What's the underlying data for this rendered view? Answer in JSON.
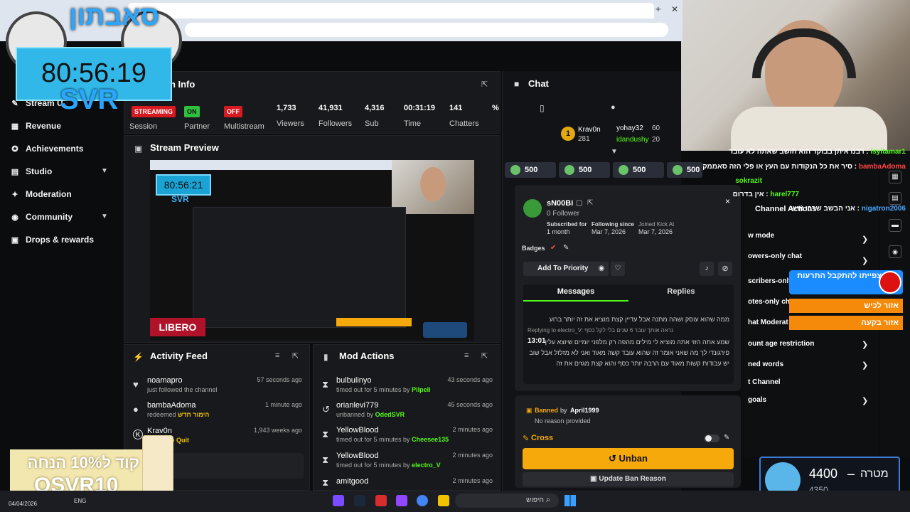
{
  "overlay": {
    "timer": "80:56:19",
    "timer_sub": "SVR",
    "logo_text": "סאבתון",
    "promo_code": "קוד ל10% הנחה",
    "promo_code2": "OSVR10",
    "libero": "LIBERO",
    "goal_label": "מטרה",
    "goal_value": "4400",
    "goal_sep": "–",
    "goal_sub": "4350",
    "alert_title": "צפייתו להתקבל התרעות",
    "alert_bar1": "אזור לכיש",
    "alert_bar2": "אזור בקעה",
    "chat_close": "×"
  },
  "overlay_chat": [
    {
      "user": "isyitamar1",
      "text": "רבנו איתן בבוקר הוא חושב שאתה לא עובר",
      "color": "#53fc18"
    },
    {
      "user": "bambaAdoma",
      "text": "סיר את כל הנקודות עם העץ או פלי הזה סאממק",
      "color": "#ff4444"
    },
    {
      "user": "sokrazit",
      "text": "",
      "color": "#53fc18"
    },
    {
      "user": "harel777",
      "text": "אין בדרום",
      "color": "#53fc18"
    },
    {
      "user": "nigatron2006",
      "text": "אני הבשב שרבו איש",
      "color": "#4aa8ff"
    }
  ],
  "browser": {
    "close": "✕",
    "new_tab": "+"
  },
  "sidebar": {
    "items": [
      {
        "label": "Stream U",
        "icon": "✎"
      },
      {
        "label": "Revenue",
        "icon": "▦"
      },
      {
        "label": "Achievements",
        "icon": "✪"
      },
      {
        "label": "Studio",
        "icon": "▤"
      },
      {
        "label": "Moderation",
        "icon": "✦"
      },
      {
        "label": "Community",
        "icon": "◉"
      },
      {
        "label": "Drops & rewards",
        "icon": "▣"
      }
    ]
  },
  "session": {
    "title": "on Info",
    "badges": {
      "streaming": "STREAMING",
      "on": "ON",
      "off": "OFF"
    },
    "labels": {
      "session": "Session",
      "partner": "Partner",
      "multistream": "Multistream"
    },
    "stats": [
      {
        "value": "1,733",
        "label": "Viewers"
      },
      {
        "value": "41,931",
        "label": "Followers"
      },
      {
        "value": "4,316",
        "label": "Sub Count"
      },
      {
        "value": "00:31:19",
        "label": "Time Live"
      },
      {
        "value": "141",
        "label": "Chatters in t..."
      },
      {
        "value": "%",
        "label": ""
      }
    ]
  },
  "preview": {
    "title": "Stream Preview",
    "timer": "80:56:21",
    "sub": "SVR"
  },
  "activity": {
    "title": "Activity Feed",
    "items": [
      {
        "name": "noamapro",
        "sub": "just followed the channel",
        "time": "57 seconds ago",
        "icon": "♥"
      },
      {
        "name": "bambaAdoma",
        "sub": "redeemed",
        "highlight": "הימור חדש",
        "time": "1 minute ago",
        "icon": "●"
      },
      {
        "name": "Krav0n",
        "sub": "just",
        "highlight": "Rage Quit",
        "time": "1,943 weeks ago",
        "icon": "K"
      },
      {
        "name": "",
        "sub": "",
        "time": "",
        "icon": ""
      }
    ]
  },
  "mod": {
    "title": "Mod Actions",
    "items": [
      {
        "name": "bulbulinyo",
        "sub": "timed out for 5 minutes by",
        "by": "Pilpeli",
        "time": "43 seconds ago",
        "icon": "⧗"
      },
      {
        "name": "orianlevi779",
        "sub": "unbanned by",
        "by": "OdedSVR",
        "time": "45 seconds ago",
        "icon": "↺"
      },
      {
        "name": "YellowBlood",
        "sub": "timed out for 5 minutes by",
        "by": "Cheesee135",
        "time": "2 minutes ago",
        "icon": "⧗"
      },
      {
        "name": "YellowBlood",
        "sub": "timed out for 5 minutes by",
        "by": "electro_V",
        "time": "2 minutes ago",
        "icon": "⧗"
      },
      {
        "name": "amitgood",
        "sub": "",
        "by": "",
        "time": "2 minutes ago",
        "icon": "⧗"
      }
    ]
  },
  "chat": {
    "title": "Chat",
    "top_users": [
      {
        "name": "Krav0n",
        "score": "281"
      },
      {
        "name": "yohay32",
        "score": "60"
      },
      {
        "name": "idandushy",
        "score": "20"
      }
    ],
    "redeem_buttons": [
      "500",
      "500",
      "500",
      "500"
    ]
  },
  "user_card": {
    "name": "sN00Bi",
    "followers": "0 Follower",
    "subscribed_label": "Subscribed for",
    "subscribed_value": "1 month",
    "following_label": "Following since",
    "following_value": "Mar 7, 2026",
    "joined_label": "Joined Kick At",
    "joined_value": "Mar 7, 2026",
    "badges_label": "Badges",
    "add_priority": "Add To Priority",
    "tab_messages": "Messages",
    "tab_replies": "Replies",
    "messages": [
      {
        "time": "",
        "text": "ממה שהוא עוסק ושהה מתנה אבל עדיין קצת מוציא את זה יותר ברוע"
      },
      {
        "time": "",
        "text": "Replying to electro_V: נראה אותך עובר 6 שנים בלי לקל כסף"
      },
      {
        "time": "13:01",
        "text": "שמע אתה הזוי אתה מוציא לי מילים מהפה רק מלפני יומיים שיוצא עליך פירגונדי לך מה שאני אומר זה שהוא עובד קשה מאוד ואני לא מזלזל אבל שוב יש עבודות קשות מאוד עם הרבה יותר כסף והוא קצת מגזים את זה"
      }
    ]
  },
  "ban": {
    "banned": "Banned",
    "by_label": "by",
    "by": "April1999",
    "reason": "No reason provided",
    "cross": "Cross",
    "unban": "Unban",
    "update": "Update Ban Reason"
  },
  "channel_actions": {
    "title": "Channel Actions",
    "items": [
      {
        "label": "w mode",
        "chev": true
      },
      {
        "label": "owers-only chat",
        "chev": true
      },
      {
        "label": "scribers-only",
        "chev": false
      },
      {
        "label": "otes-only cha",
        "chev": false
      },
      {
        "label": "hat Moderat",
        "chev": false
      },
      {
        "label": "ount age restriction",
        "chev": true
      },
      {
        "label": "ned words",
        "chev": true
      },
      {
        "label": "t Channel",
        "chev": false
      },
      {
        "label": "goals",
        "chev": true
      }
    ]
  },
  "taskbar": {
    "date": "04/04/2026",
    "lang": "ENG",
    "search": "חיפוש"
  },
  "colors": {
    "kick_green": "#53fc18",
    "unban_orange": "#f5a90a",
    "alert_blue": "#1a8cff"
  }
}
